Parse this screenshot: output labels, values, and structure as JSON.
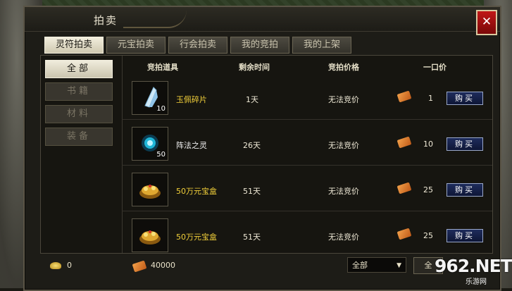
{
  "window": {
    "title": "拍卖"
  },
  "tabs": [
    {
      "label": "灵符拍卖",
      "active": true
    },
    {
      "label": "元宝拍卖",
      "active": false
    },
    {
      "label": "行会拍卖",
      "active": false
    },
    {
      "label": "我的竞拍",
      "active": false
    },
    {
      "label": "我的上架",
      "active": false
    }
  ],
  "categories": [
    {
      "label": "全部",
      "active": true
    },
    {
      "label": "书籍",
      "active": false
    },
    {
      "label": "材料",
      "active": false
    },
    {
      "label": "装备",
      "active": false
    }
  ],
  "table": {
    "headers": [
      "竞拍道具",
      "剩余时间",
      "竞拍价格",
      "一口价"
    ],
    "rows": [
      {
        "icon": "jade-shard-icon",
        "qty": "10",
        "name": "玉佩碎片",
        "name_color": "#f2d03a",
        "time": "1天",
        "bid": "无法竞价",
        "price": "1",
        "buy": "购买"
      },
      {
        "icon": "blue-orb-icon",
        "qty": "50",
        "name": "阵法之灵",
        "name_color": "#f0f0f0",
        "time": "26天",
        "bid": "无法竞价",
        "price": "10",
        "buy": "购买"
      },
      {
        "icon": "treasure-chest-icon",
        "qty": "",
        "name": "50万元宝盒",
        "name_color": "#f2d03a",
        "time": "51天",
        "bid": "无法竞价",
        "price": "25",
        "buy": "购买"
      },
      {
        "icon": "treasure-chest-icon",
        "qty": "",
        "name": "50万元宝盒",
        "name_color": "#f2d03a",
        "time": "51天",
        "bid": "无法竞价",
        "price": "25",
        "buy": "购买"
      }
    ]
  },
  "footer": {
    "gold": "0",
    "tickets": "40000",
    "filter_value": "全部",
    "search_label": "全"
  },
  "watermark": {
    "brand": "962.NET",
    "sub": "乐游网"
  }
}
